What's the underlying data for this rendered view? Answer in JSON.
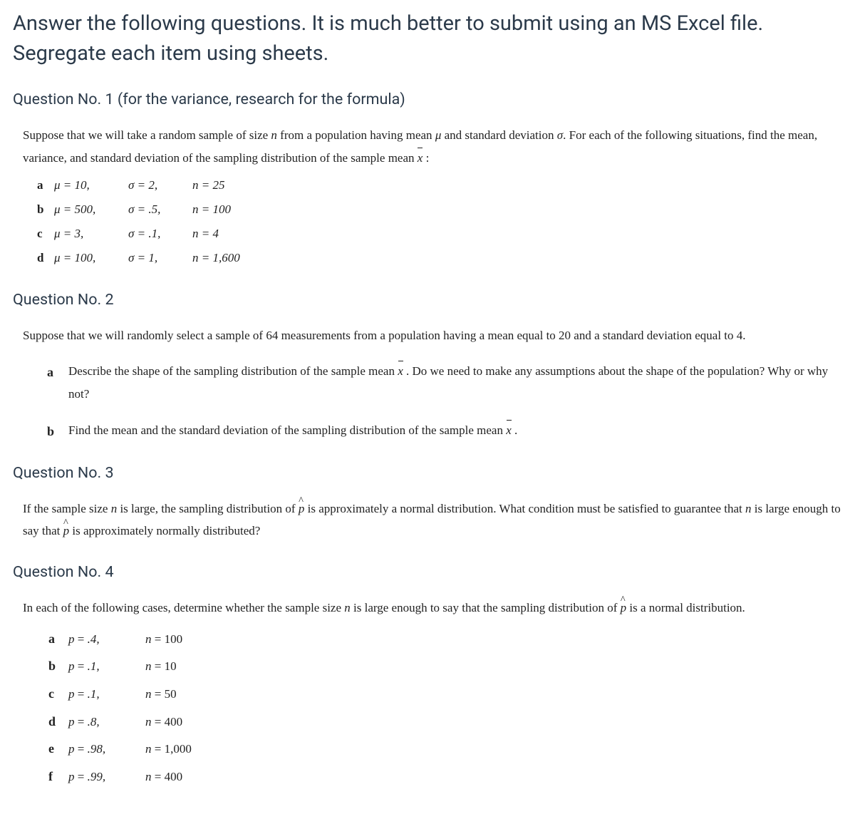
{
  "title": "Answer the following questions. It is much better to submit using an MS Excel file. Segregate each item using sheets.",
  "q1": {
    "header": "Question No. 1 (for the variance, research for the formula)",
    "intro_a": "Suppose that we will take a random sample of size ",
    "intro_b": " from a population having mean ",
    "intro_c": " and standard deviation ",
    "intro_d": ". For each of the following situations, find the mean, variance, and standard deviation of the sampling distribution of the sample mean ",
    "intro_e": ":",
    "rows": [
      {
        "lbl": "a",
        "mu": "μ = 10,",
        "sig": "σ = 2,",
        "n": "n = 25"
      },
      {
        "lbl": "b",
        "mu": "μ = 500,",
        "sig": "σ = .5,",
        "n": "n = 100"
      },
      {
        "lbl": "c",
        "mu": "μ = 3,",
        "sig": "σ = .1,",
        "n": "n = 4"
      },
      {
        "lbl": "d",
        "mu": "μ = 100,",
        "sig": "σ = 1,",
        "n": "n = 1,600"
      }
    ]
  },
  "q2": {
    "header": "Question No. 2",
    "intro": "Suppose that we will randomly select a sample of 64 measurements from a population having a mean equal to 20 and a standard deviation equal to 4.",
    "a_pre": "Describe the shape of the sampling distribution of the sample mean ",
    "a_post": ". Do we need to make any assumptions about the shape of the population? Why or why not?",
    "b_pre": "Find the mean and the standard deviation of the sampling distribution of the sample mean ",
    "b_post": "."
  },
  "q3": {
    "header": "Question No. 3",
    "p1a": "If the sample size ",
    "p1b": " is large, the sampling distribution of ",
    "p1c": " is approximately a normal distribution. What condition must be satisfied to guarantee that ",
    "p1d": " is large enough to say that ",
    "p1e": " is approximately normally distributed?"
  },
  "q4": {
    "header": "Question No. 4",
    "intro_a": "In each of the following cases, determine whether the sample size ",
    "intro_b": " is large enough to say that the sampling distribution of ",
    "intro_c": " is a normal distribution.",
    "rows": [
      {
        "lbl": "a",
        "p": ".4,",
        "n": "100"
      },
      {
        "lbl": "b",
        "p": ".1,",
        "n": "10"
      },
      {
        "lbl": "c",
        "p": ".1,",
        "n": "50"
      },
      {
        "lbl": "d",
        "p": ".8,",
        "n": "400"
      },
      {
        "lbl": "e",
        "p": ".98,",
        "n": "1,000"
      },
      {
        "lbl": "f",
        "p": ".99,",
        "n": "400"
      }
    ]
  }
}
